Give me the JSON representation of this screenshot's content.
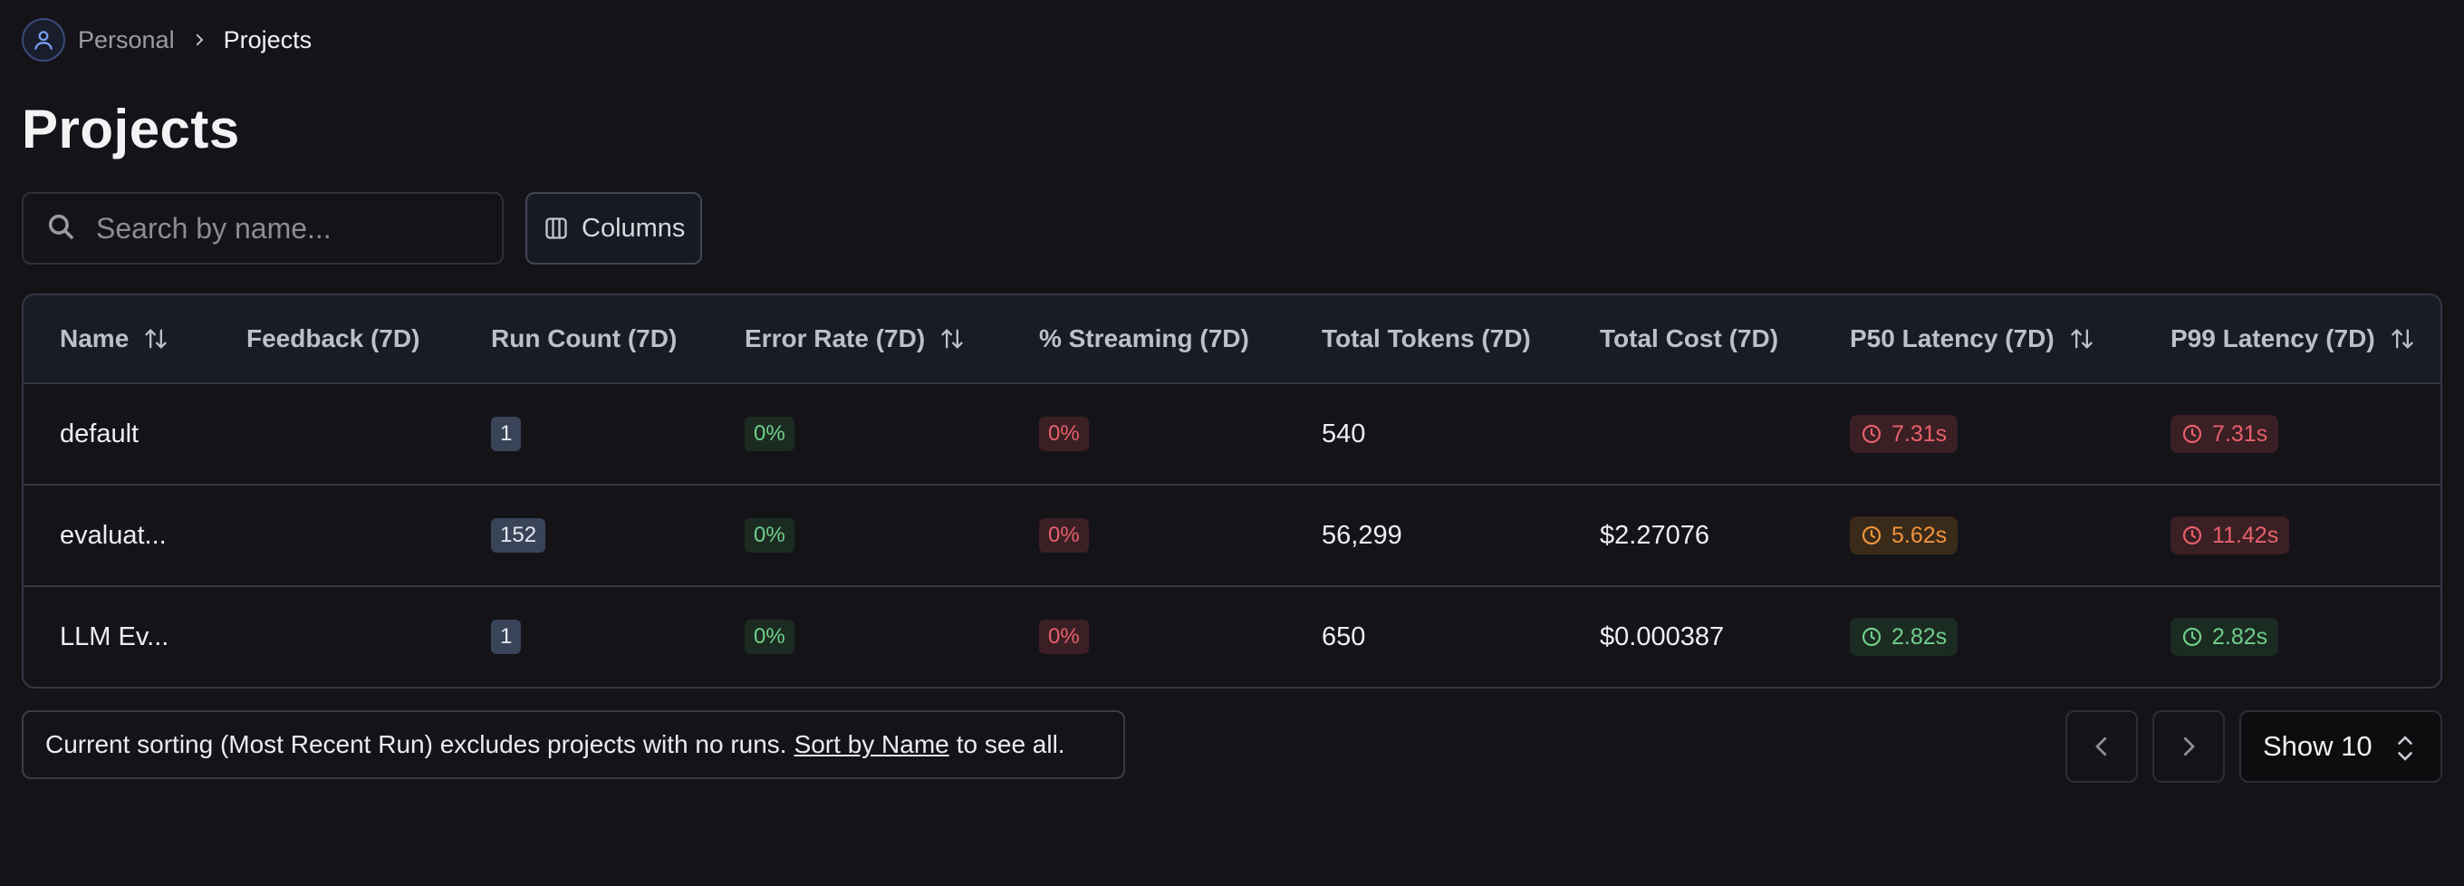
{
  "breadcrumb": {
    "items": [
      "Personal",
      "Projects"
    ]
  },
  "page_title": "Projects",
  "toolbar": {
    "search_placeholder": "Search by name...",
    "columns_label": "Columns"
  },
  "table": {
    "headers": [
      "Name",
      "Feedback (7D)",
      "Run Count (7D)",
      "Error Rate (7D)",
      "% Streaming (7D)",
      "Total Tokens (7D)",
      "Total Cost (7D)",
      "P50 Latency (7D)",
      "P99 Latency (7D)"
    ],
    "rows": [
      {
        "name": "default",
        "run_count": "1",
        "error_rate": "0%",
        "streaming": "0%",
        "tokens": "540",
        "cost": "",
        "p50": "7.31s",
        "p50_status": "red",
        "p99": "7.31s",
        "p99_status": "red"
      },
      {
        "name": "evaluat...",
        "run_count": "152",
        "error_rate": "0%",
        "streaming": "0%",
        "tokens": "56,299",
        "cost": "$2.27076",
        "p50": "5.62s",
        "p50_status": "orange",
        "p99": "11.42s",
        "p99_status": "red"
      },
      {
        "name": "LLM Ev...",
        "run_count": "1",
        "error_rate": "0%",
        "streaming": "0%",
        "tokens": "650",
        "cost": "$0.000387",
        "p50": "2.82s",
        "p50_status": "green",
        "p99": "2.82s",
        "p99_status": "green"
      }
    ]
  },
  "footer": {
    "notice_prefix": "Current sorting (Most Recent Run) excludes projects with no runs.",
    "notice_link": "Sort by Name",
    "notice_suffix": "to see all.",
    "show_label": "Show 10"
  },
  "icons": {
    "avatar": "user-icon",
    "breadcrumb_sep": "chevron-right-icon",
    "search": "search-icon",
    "columns": "columns-icon",
    "sort": "sort-arrows-icon",
    "latency": "clock-icon",
    "prev": "chevron-left-icon",
    "next": "chevron-right-icon",
    "select": "chevron-up-down-icon"
  },
  "colors": {
    "background": "#141318",
    "status_red": "#e8606b",
    "status_orange": "#f0943d",
    "status_green": "#6fd08a"
  }
}
